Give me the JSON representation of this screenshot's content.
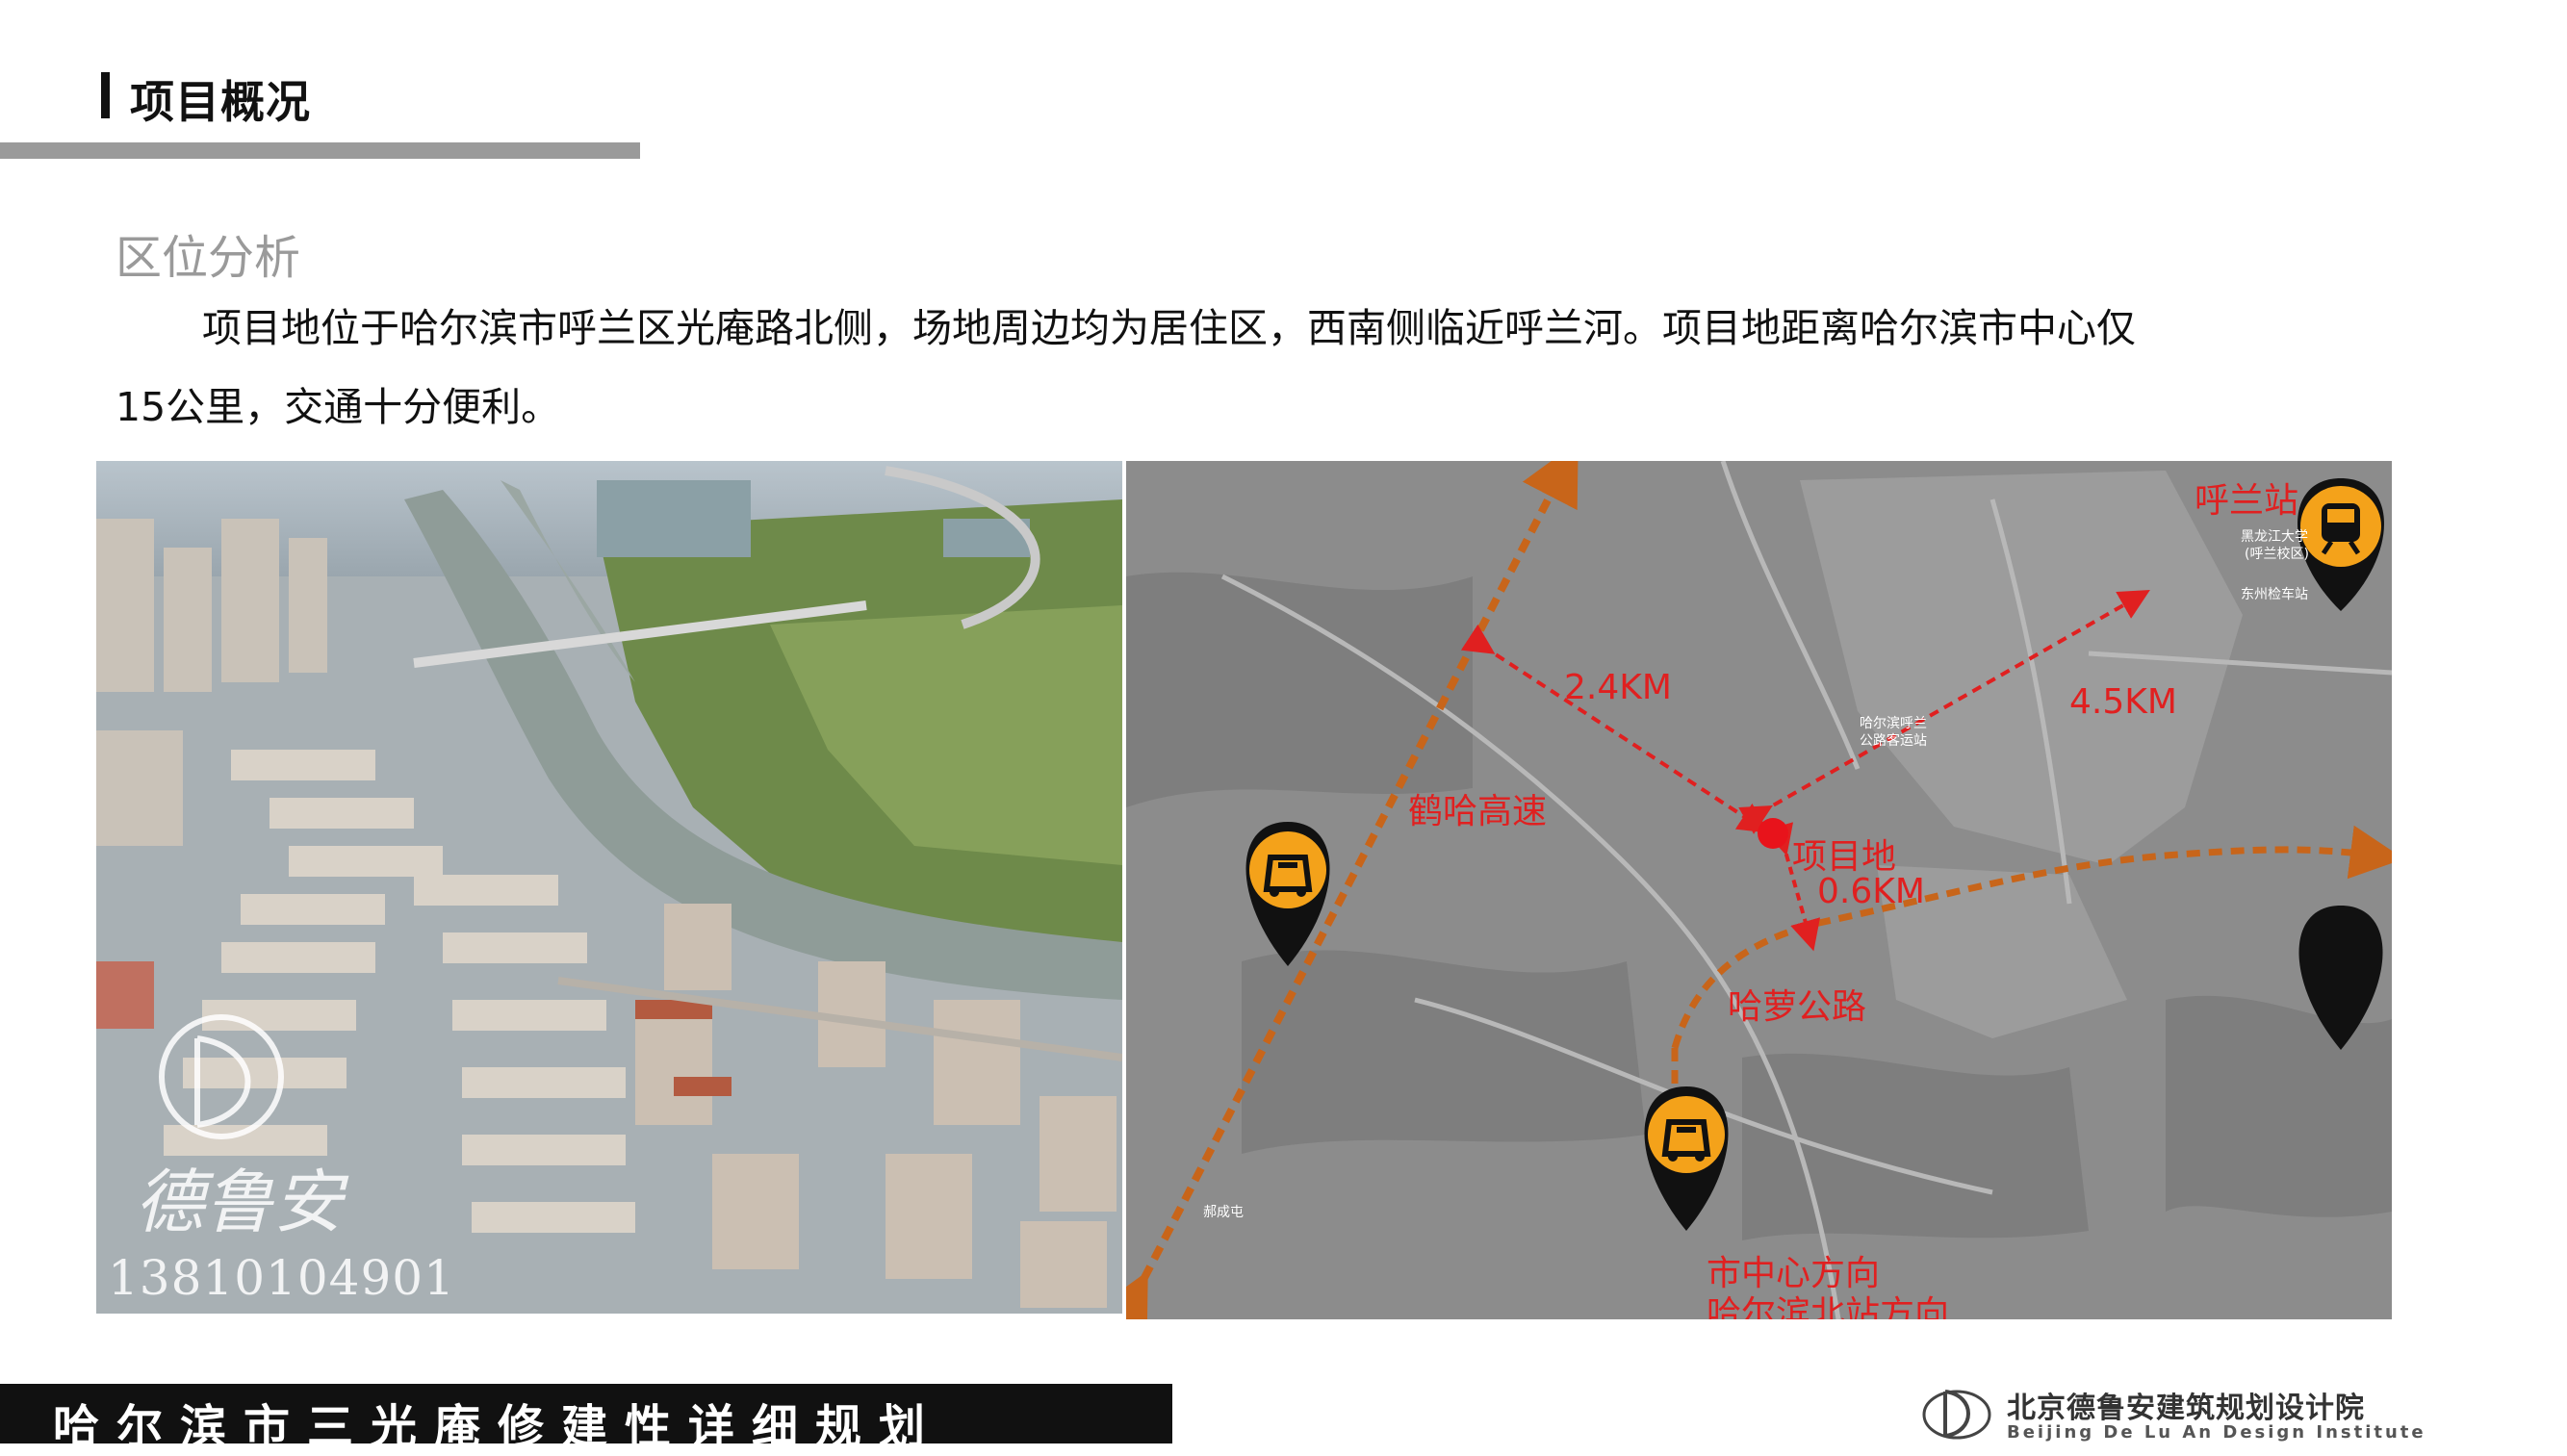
{
  "header": {
    "title": "项目概况"
  },
  "section": {
    "subtitle": "区位分析",
    "paragraph_line1": "项目地位于哈尔滨市呼兰区光庵路北侧，场地周边均为居住区，西南侧临近呼兰河。项目地距离哈尔滨市中心仅",
    "paragraph_line2": "15公里，交通十分便利。"
  },
  "photo": {
    "watermark_text": "德鲁安",
    "watermark_phone": "13810104901"
  },
  "map": {
    "labels": {
      "site": "项目地",
      "highway": "鹤哈高速",
      "road": "哈萝公路",
      "station": "呼兰站",
      "city_center": "市中心方向",
      "north_station": "哈尔滨北站方向",
      "dist_highway": "2.4KM",
      "dist_station": "4.5KM",
      "dist_road": "0.6KM"
    },
    "small_labels": {
      "university": "黑龙江大学",
      "campus": "(呼兰校区)",
      "inspection": "东州检车站",
      "bus_station_1": "哈尔滨呼兰",
      "bus_station_2": "公路客运站",
      "town": "郝成屯"
    },
    "colors": {
      "route": "#c8651a",
      "distance": "#e02020",
      "pin": "#111111",
      "pin_icon": "#f4a21a"
    },
    "icons": [
      "car-pin-icon",
      "train-pin-icon"
    ]
  },
  "footer": {
    "title": "哈尔滨市三光庵修建性详细规划",
    "org_cn": "北京德鲁安建筑规划设计院",
    "org_en": "Beijing De Lu An Design Institute"
  }
}
